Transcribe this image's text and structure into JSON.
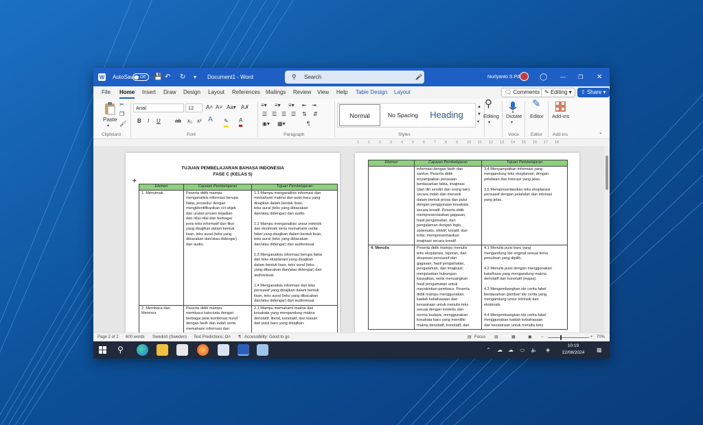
{
  "titlebar": {
    "autosave": "AutoSave",
    "toggle": "Off",
    "doc_title": "Document1 - Word",
    "search": "Search",
    "user": "Nurlyanto S.Pd"
  },
  "menu": {
    "tabs": [
      "File",
      "Home",
      "Insert",
      "Draw",
      "Design",
      "Layout",
      "References",
      "Mailings",
      "Review",
      "View",
      "Help",
      "Table Design",
      "Layout"
    ],
    "comments": "Comments",
    "editing": "Editing",
    "share": "Share"
  },
  "ribbon": {
    "paste": "Paste",
    "clipboard": "Clipboard",
    "font_name": "Arial",
    "font_size": "12",
    "font": "Font",
    "paragraph": "Paragraph",
    "style_normal": "Normal",
    "style_nospacing": "No Spacing",
    "style_heading": "Heading",
    "styles": "Styles",
    "editing": "Editing",
    "dictate": "Dictate",
    "editor": "Editor",
    "voice": "Voice",
    "editor_group": "Editor",
    "addins": "Add-ins",
    "addins_group": "Add-ins"
  },
  "ruler": {
    "marks": [
      "1",
      "1",
      "2",
      "3",
      "4",
      "5",
      "6",
      "7",
      "8",
      "9",
      "10",
      "11",
      "12",
      "13",
      "14",
      "15",
      "16",
      "17",
      "18"
    ]
  },
  "doc": {
    "title1": "TUJUAN PEMBELAJARAN BAHASA INDONESIA",
    "title2": "FASE C (KELAS 5)",
    "headers": [
      "Elemen",
      "Capaian Pembelajaran",
      "Tujuan Pembelajaran"
    ],
    "page1_rows": [
      [
        "1. Menyimak",
        "Peserta didik mampu\nmenganalisis informasi berupa\nfakta, prosedur dengan\nmengidentifikasikan ciri objek\ndan urutan proses kejadian\ndan nilai-nilai dan berbagai\njenis teks informatif dan fiksi\nyang disajikan dalam bentuk\nlisan, teks aural (teks yang\ndibacakan dan/atau didengar)\ndan audio.",
        "1.1 Mampu menganalisis informasi dan\nmemahami makna dan puisi baru yang\ndisajikan dalam bentuk lisan,\nteks aural (teks yang dibacakan\ndan/atau didengar) dan audio.\n\n1.2 Mampu menganalisis unsur intrinsik\ndan ekstrinsik serta memahami cerita\nfabel yang disajikan dalam bentuk lisan,\nteks aural (teks yang dibacakan\ndan/atau didengar) dan audiovisual.\n\n1.3 Menganalisis informasi berupa fakta\ndari teks eksplanasi yang disajikan\ndalam bentuk lisan, teks aural (teks\nyang dibacakan dan/atau didengar) dan\naudiovisual.\n\n1.4 Menganalisis informasi dari teks\npersuasif yang disajikan dalam bentuk\nlisan, teks aural (teks yang dibacakan\ndan/atau didengar) dan audiovisual."
      ],
      [
        "2. Membaca dan\nMemirsa",
        "Peserta didik mampu\nmembaca kata-kata dengan\nberbagai pola kombinasi huruf\ndengan fasih dan indah serta\nmemahami informasi dan",
        "2.1 Mampu memahami makna dari\nkosakata yang mengandung makna\ndenotatif, literal, konotatif, dan kiasan\ndari puisi baru yang disajikan."
      ]
    ],
    "page2_rows": [
      [
        "",
        "informasi dengan fasih dan\nsantun. Peserta didik\nenyampaikan perasaan\nberdasarkan fakta, imajinasi\n(dari diri sendiri dan orang lain)\nsecara indah dan menarik\ndalam bentuk prosa dan puisi\ndengan penggunaan kosakata\nsecara kreatif. Peserta didik\nmempresentasikan gagasan,\nhasil pengamatan, dan\npengalaman dengan logis,\nsistematis, efektif, kreatif, dan\nkritis; mempresentasikan\nimajinasi secara kreatif.",
        "3.4 Menyampaikan informasi yang\nmengandung teks eksplanasi; dengan\npelafalan dan intonasi yang jelas.\n\n3.5 Mempresentasikan teks eksplanasi\npersuasif dengan pelafalan dan intonasi\nyang jelas."
      ],
      [
        "4. Menulis",
        "Peserta didik mampu menulis\nteks eksplanasi, laporan, dan\neksposisi persuasif dari\ngagasan, hasil pengamalan,\npengalaman, dan imajinasi;\nmenjelaskan hubungan\nkausalitas, serta menuangkan\nhasil pengamatan untuk\nmeyakinkan pembaca. Peserta\ndidik mampu menggunakan\nkaidah kebahasaan dan\nkesastraan untuk menulis teks\nsesuai dengan konteks dan\nnorma budaya; menggunakan\nkosakata baru yang memiliki\nmakna denotatif, konotatif, dan",
        "4.1 Menulis puisi baru yang\nmengandung ide original sesuai tema\npenulisan yang dipilih.\n\n4.2 Menulis puisi dengan menggunakan\nkata/frasa yang mengandung makna\ndenotatif dan konotatif (majas).\n\n4.3 Mengembangkan ide cerita fabel\nberdasarkan gambar/ ide cerita yang\nmengandung unsur intrinsik dan\nekstrinsik.\n\n4.4 Mengembangkan ide cerita fabel\nmenggunakan kaidah kebahasaan\ndan kesastraan untuk menulis teks"
      ]
    ]
  },
  "status": {
    "page": "Page 2 of 2",
    "words": "600 words",
    "lang": "Swedish (Sweden)",
    "predictions": "Text Predictions: On",
    "accessibility": "Accessibility: Good to go",
    "focus": "Focus",
    "zoom": "70%"
  },
  "taskbar": {
    "time": "10:19",
    "date": "22/08/2024",
    "apps": [
      "windows-start",
      "search",
      "edge",
      "file-explorer",
      "store",
      "firefox",
      "paint",
      "word",
      "photos"
    ]
  },
  "colors": {
    "title_blue": "#1d5fc4",
    "table_header": "#8dd17e"
  }
}
